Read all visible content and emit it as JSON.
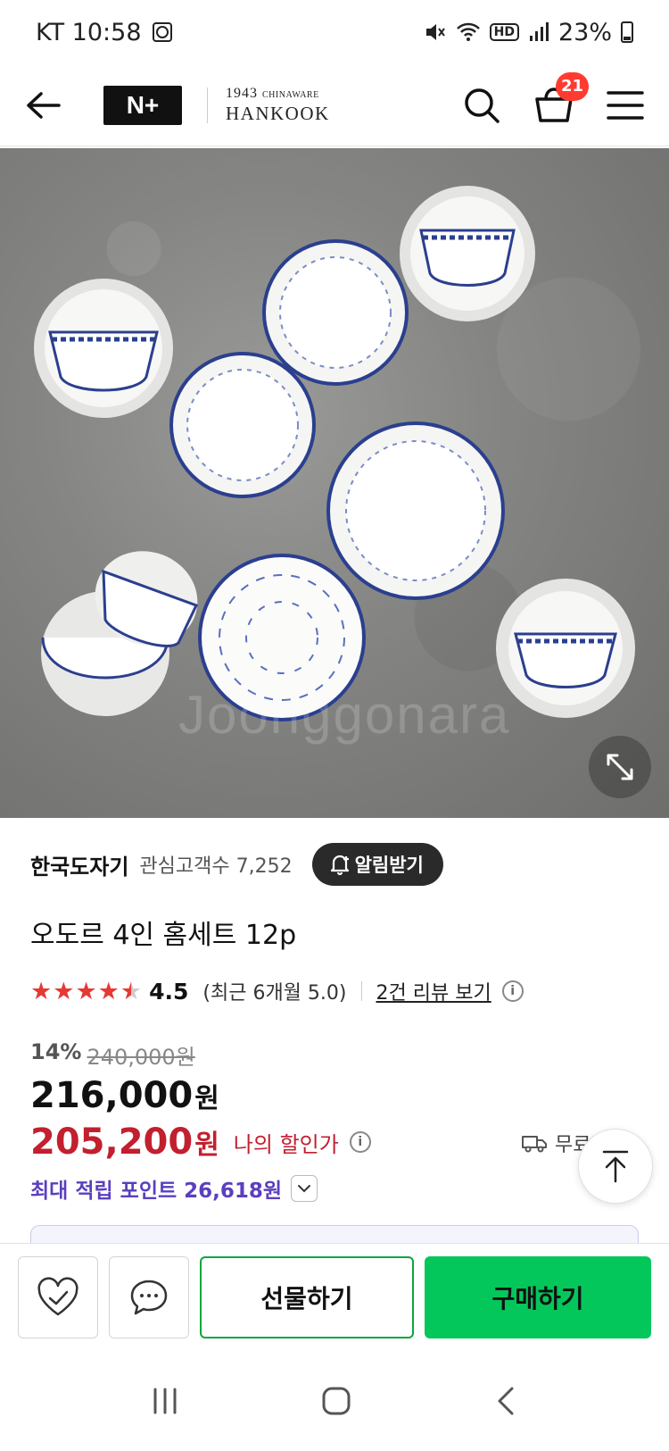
{
  "status_bar": {
    "carrier_time": "KT 10:58",
    "hd": "HD",
    "battery": "23%"
  },
  "header": {
    "logo": "N+",
    "brand_year": "1943",
    "brand_sub": "CHINAWARE",
    "brand_name": "HANKOOK",
    "cart_count": "21"
  },
  "image": {
    "watermark": "Joonggonara"
  },
  "seller": {
    "name": "한국도자기",
    "interest": "관심고객수 7,252",
    "alarm_label": "알림받기"
  },
  "product": {
    "title": "오도르 4인 홈세트 12p"
  },
  "rating": {
    "score": "4.5",
    "stars_value": 4.5,
    "recent": "(최근 6개월 5.0)",
    "review_link": "2건 리뷰 보기"
  },
  "pricing": {
    "discount_pct": "14%",
    "original_price": "240,000원",
    "price": "216,000",
    "price_unit": "원",
    "my_price": "205,200",
    "my_price_unit": "원",
    "my_price_label": "나의 할인가",
    "shipping": "무료배송"
  },
  "points": {
    "label": "최대 적립 포인트 26,618원"
  },
  "bottom_bar": {
    "gift_label": "선물하기",
    "buy_label": "구매하기"
  },
  "colors": {
    "accent_green": "#03c75a",
    "sale_red": "#c21f2f",
    "points_purple": "#5b3fbf",
    "badge_red": "#ff3b30"
  }
}
